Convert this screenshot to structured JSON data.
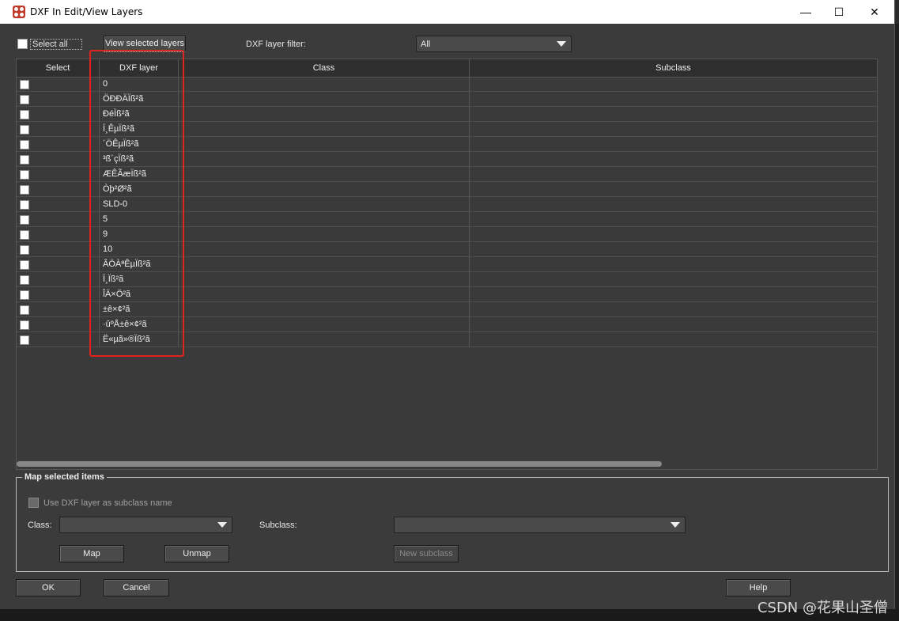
{
  "window": {
    "title": "DXF In Edit/View Layers",
    "minimize_glyph": "—",
    "maximize_glyph": "☐",
    "close_glyph": "✕"
  },
  "toolbar": {
    "select_all_label": "Select all",
    "view_selected_label": "View selected layers",
    "filter_label": "DXF layer filter:",
    "filter_value": "All"
  },
  "table": {
    "columns": [
      "Select",
      "DXF layer",
      "Class",
      "Subclass"
    ],
    "rows": [
      {
        "layer": "0"
      },
      {
        "layer": "ÖÐÐÄÏß²ã"
      },
      {
        "layer": "ÐéÏß²ã"
      },
      {
        "layer": "Ï¸ÊµÏß²ã"
      },
      {
        "layer": "´ÖÊµÏß²ã"
      },
      {
        "layer": "³ß´çÏß²ã"
      },
      {
        "layer": "ÆÊÃæÏß²ã"
      },
      {
        "layer": "Òþ²Ø²ã"
      },
      {
        "layer": "SLD-0"
      },
      {
        "layer": "5"
      },
      {
        "layer": "9"
      },
      {
        "layer": "10"
      },
      {
        "layer": "ÂÖÀªÊµÏß²ã"
      },
      {
        "layer": "Ï¸Ïß²ã"
      },
      {
        "layer": "ÎÄ×Ö²ã"
      },
      {
        "layer": "±ê×¢²ã"
      },
      {
        "layer": "·ûºÅ±ê×¢²ã"
      },
      {
        "layer": "Ë«µã»®Ïß²ã"
      }
    ]
  },
  "map_group": {
    "title": "Map selected items",
    "use_dxf_layer_label": "Use DXF layer as subclass name",
    "class_label": "Class:",
    "subclass_label": "Subclass:",
    "map_label": "Map",
    "unmap_label": "Unmap",
    "new_subclass_label": "New subclass"
  },
  "footer": {
    "ok_label": "OK",
    "cancel_label": "Cancel",
    "help_label": "Help"
  },
  "watermark": "CSDN @花果山圣僧",
  "colors": {
    "dialog_bg": "#3b3b3b",
    "highlight_box": "#e0231f"
  }
}
